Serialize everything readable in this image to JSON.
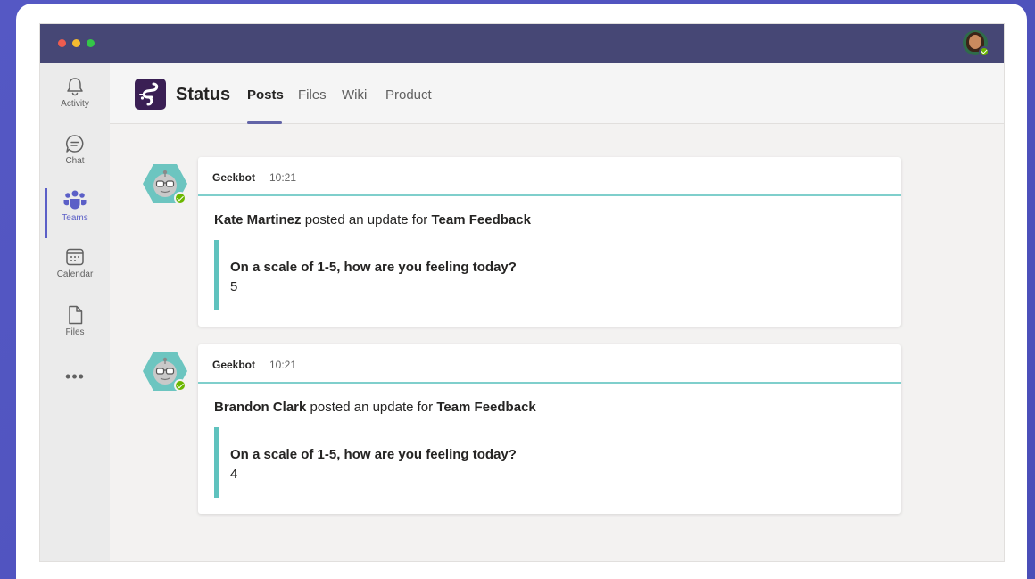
{
  "window": {
    "controls": [
      "close",
      "minimize",
      "maximize"
    ]
  },
  "rail": [
    {
      "label": "Activity",
      "icon": "bell-icon"
    },
    {
      "label": "Chat",
      "icon": "chat-icon"
    },
    {
      "label": "Teams",
      "icon": "teams-icon",
      "active": true
    },
    {
      "label": "Calendar",
      "icon": "calendar-icon"
    },
    {
      "label": "Files",
      "icon": "file-icon"
    }
  ],
  "more_label": "•••",
  "header": {
    "app_name": "Status",
    "tabs": [
      "Posts",
      "Files",
      "Wiki",
      "Product"
    ],
    "active_tab": "Posts"
  },
  "posts": [
    {
      "author": "Geekbot",
      "time": "10:21",
      "user": "Kate Martinez",
      "action": " posted an update for ",
      "team": "Team Feedback",
      "question": "On a scale of 1-5, how are you feeling today?",
      "answer": "5"
    },
    {
      "author": "Geekbot",
      "time": "10:21",
      "user": "Brandon Clark",
      "action": " posted an update for ",
      "team": "Team Feedback",
      "question": "On a scale of 1-5, how are you feeling today?",
      "answer": "4"
    }
  ],
  "colors": {
    "background": "#5558c4",
    "titlebar": "#464775",
    "accent": "#5b5fc7",
    "quote_border": "#5fc2be",
    "presence": "#6bb700"
  }
}
